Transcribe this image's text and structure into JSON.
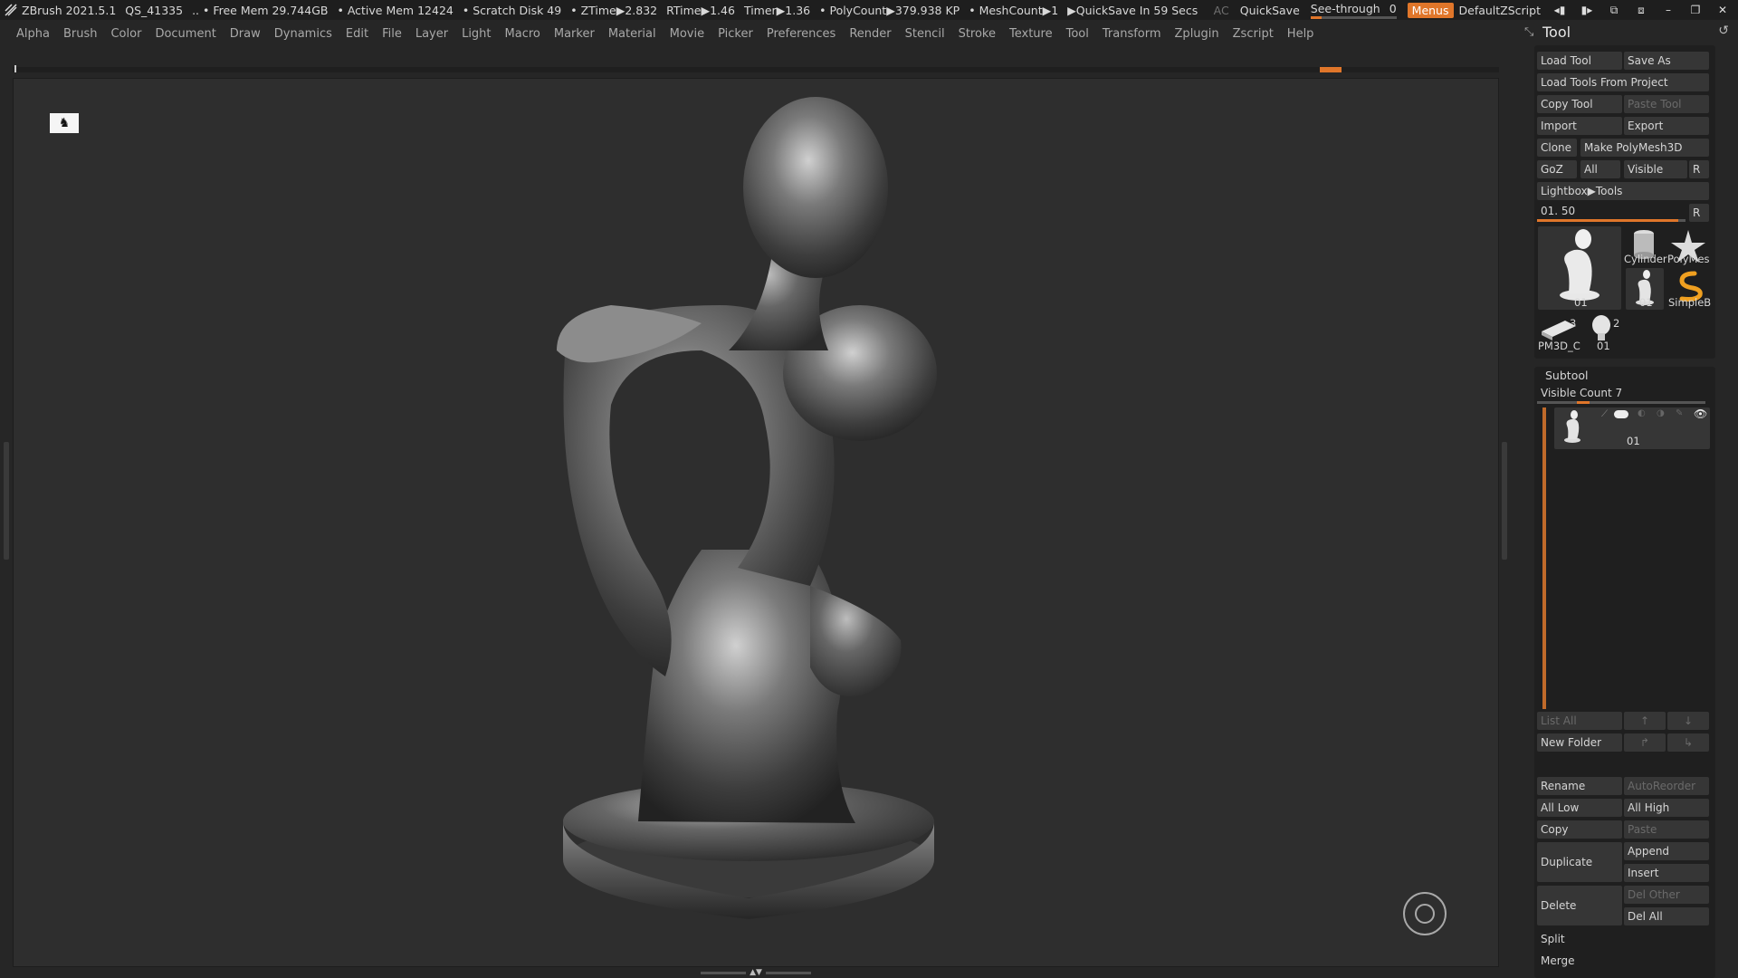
{
  "titlebar": {
    "app": "ZBrush 2021.5.1",
    "quicksave_id": "QS_41335",
    "free_mem": ".. • Free Mem 29.744GB",
    "active_mem": "• Active Mem 12424",
    "scratch_disk": "• Scratch Disk 49",
    "ztime": "• ZTime▶2.832",
    "rtime": "RTime▶1.46",
    "timer": "Timer▶1.36",
    "polycount": "• PolyCount▶379.938 KP",
    "meshcount": "• MeshCount▶1",
    "quicksave_in": "▶QuickSave In 59 Secs",
    "ac": "AC",
    "quicksave": "QuickSave",
    "see_through_label": "See-through",
    "see_through_value": "0",
    "menus": "Menus",
    "default_zscript": "DefaultZScript"
  },
  "menubar": {
    "items": [
      "Alpha",
      "Brush",
      "Color",
      "Document",
      "Draw",
      "Dynamics",
      "Edit",
      "File",
      "Layer",
      "Light",
      "Macro",
      "Marker",
      "Material",
      "Movie",
      "Picker",
      "Preferences",
      "Render",
      "Stencil",
      "Stroke",
      "Texture",
      "Tool",
      "Transform",
      "Zplugin",
      "Zscript",
      "Help"
    ]
  },
  "viewport": {
    "thumb_icon": "model-icon"
  },
  "tool_panel": {
    "title": "Tool",
    "buttons": {
      "load_tool": "Load Tool",
      "save_as": "Save As",
      "load_from_project": "Load Tools From Project",
      "copy_tool": "Copy Tool",
      "paste_tool": "Paste Tool",
      "import": "Import",
      "export": "Export",
      "clone": "Clone",
      "make_polymesh": "Make PolyMesh3D",
      "goz": "GoZ",
      "all": "All",
      "visible": "Visible",
      "r": "R",
      "lightbox_tools": "Lightbox▶Tools"
    },
    "slider": {
      "label": "01. 50",
      "r": "R",
      "level": 0.95
    },
    "thumbnails": {
      "main": "01",
      "cylinder": "Cylinder",
      "polymesh": "PolyMes",
      "small_01": "01",
      "simpleb": "SimpleB",
      "pm3d": "PM3D_C",
      "pm3d_count": "3",
      "head_01": "01",
      "head_count": "2"
    }
  },
  "subtool": {
    "title": "Subtool",
    "visible_count": "Visible Count 7",
    "item_label": "01",
    "buttons": {
      "list_all": "List All",
      "new_folder": "New Folder",
      "rename": "Rename",
      "auto_reorder": "AutoReorder",
      "all_low": "All Low",
      "all_high": "All High",
      "copy": "Copy",
      "paste": "Paste",
      "duplicate": "Duplicate",
      "append": "Append",
      "insert": "Insert",
      "delete": "Delete",
      "del_other": "Del Other",
      "del_all": "Del All",
      "split": "Split",
      "merge": "Merge"
    }
  },
  "colors": {
    "accent": "#e0762a",
    "background": "#262626",
    "viewport": "#2e2e2e"
  }
}
